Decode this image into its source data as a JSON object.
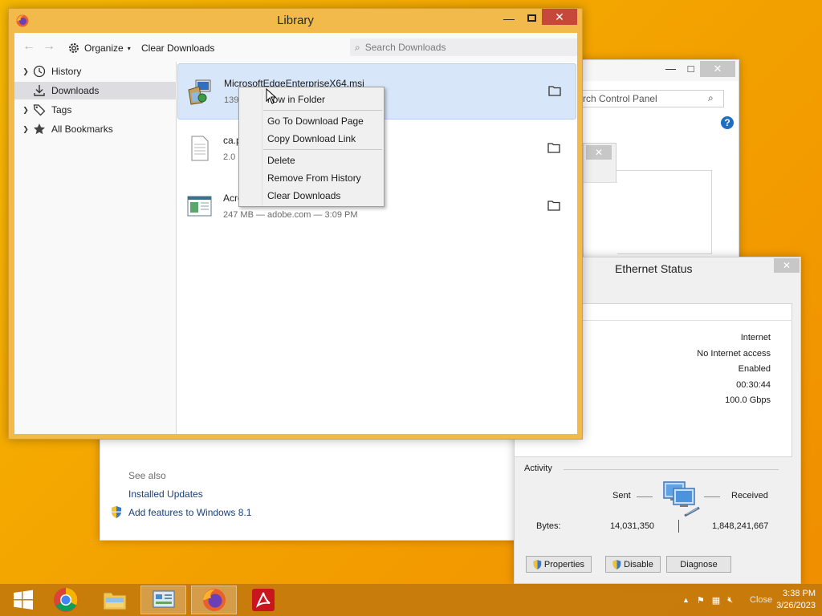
{
  "control_panel": {
    "search_placeholder": "rch Control Panel",
    "see_also": "See also",
    "links": [
      "Installed Updates",
      "Add features to Windows 8.1"
    ]
  },
  "ethernet": {
    "title": "Ethernet Status",
    "values": [
      "Internet",
      "No Internet access",
      "Enabled",
      "00:30:44",
      "100.0 Gbps"
    ],
    "activity": "Activity",
    "sent": "Sent",
    "received": "Received",
    "bytes_label": "Bytes:",
    "bytes_sent": "14,031,350",
    "bytes_received": "1,848,241,667",
    "buttons": {
      "properties": "Properties",
      "disable": "Disable",
      "diagnose": "Diagnose"
    }
  },
  "library": {
    "title": "Library",
    "toolbar": {
      "organize": "Organize",
      "clear_downloads": "Clear Downloads",
      "search_placeholder": "Search Downloads"
    },
    "sidebar": [
      {
        "label": "History"
      },
      {
        "label": "Downloads"
      },
      {
        "label": "Tags"
      },
      {
        "label": "All Bookmarks"
      }
    ],
    "downloads": [
      {
        "name": "MicrosoftEdgeEnterpriseX64.msi",
        "meta": "139"
      },
      {
        "name": "ca.p",
        "meta": "2.0 I"
      },
      {
        "name": "Acro",
        "meta": "247 MB — adobe.com — 3:09 PM"
      }
    ]
  },
  "context_menu": {
    "items": [
      "Show in Folder",
      "Go To Download Page",
      "Copy Download Link",
      "Delete",
      "Remove From History",
      "Clear Downloads"
    ],
    "first_visible": "how in Folder"
  },
  "taskbar": {
    "time": "3:38 PM",
    "date": "3/26/2023",
    "close_ghost": "Close"
  },
  "colors": {
    "desktop": "#f3a400",
    "library_frame": "#f1ba4b",
    "library_close": "#c7473a",
    "selection": "#d7e6f9",
    "taskbar": "#c47a0c"
  }
}
